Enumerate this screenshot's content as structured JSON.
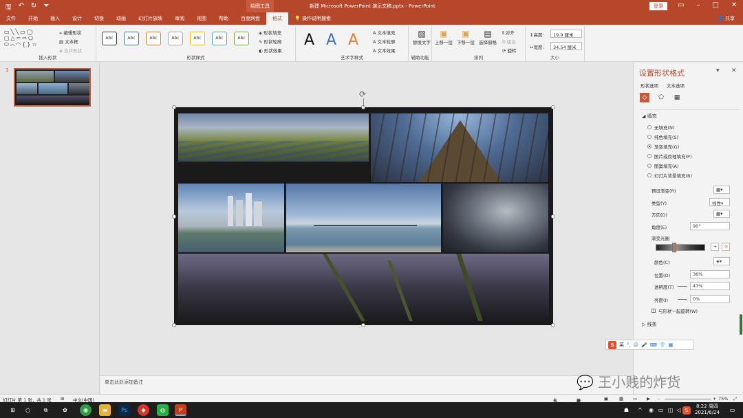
{
  "titlebar": {
    "context_tab": "绘图工具",
    "document_title": "新建 Microsoft PowerPoint 演示文稿.pptx  -  PowerPoint",
    "login_label": "登录",
    "share_label": "共享"
  },
  "tabs": [
    "文件",
    "开始",
    "插入",
    "设计",
    "切换",
    "动画",
    "幻灯片放映",
    "审阅",
    "视图",
    "帮助",
    "百度网盘",
    "格式",
    "操作说明搜索"
  ],
  "ribbon": {
    "insert_shapes": {
      "label": "插入形状",
      "edit_shape": "编辑形状",
      "text_box": "文本框",
      "merge_shapes": "合并形状"
    },
    "shape_styles": {
      "label": "形状样式",
      "preset": "Abc",
      "fill": "形状填充",
      "outline": "形状轮廓",
      "effects": "形状效果"
    },
    "wordart": {
      "label": "艺术字样式",
      "letter": "A",
      "text_fill": "文本填充",
      "text_outline": "文本轮廓",
      "text_effects": "文本效果"
    },
    "accessibility": {
      "label": "辅助功能",
      "alt_text": "替换文字"
    },
    "arrange": {
      "label": "排列",
      "bring_forward": "上移一层",
      "send_backward": "下移一层",
      "selection_pane": "选择窗格",
      "align": "对齐",
      "group": "组合",
      "rotate": "旋转"
    },
    "size": {
      "label": "大小",
      "height_label": "高度:",
      "height_value": "19.9 厘米",
      "width_label": "宽度:",
      "width_value": "34.54 厘米"
    }
  },
  "slides_panel": {
    "slide_number": "1"
  },
  "notes": {
    "placeholder": "单击此处添加备注"
  },
  "format_pane": {
    "title": "设置形状格式",
    "subtabs": [
      "形状选项",
      "文本选项"
    ],
    "fill_section": "填充",
    "fill_options": [
      "无填充(N)",
      "纯色填充(S)",
      "渐变填充(G)",
      "图片或纹理填充(P)",
      "图案填充(A)",
      "幻灯片背景填充(B)"
    ],
    "selected_fill": "渐变填充(G)",
    "preset_gradient": "预设渐变(R)",
    "type_label": "类型(Y)",
    "type_value": "线性",
    "direction_label": "方向(D)",
    "angle_label": "角度(E)",
    "angle_value": "90°",
    "gradient_stops": "渐变光圈",
    "color_label": "颜色(C)",
    "position_label": "位置(O)",
    "position_value": "36%",
    "transparency_label": "透明度(T)",
    "transparency_value": "47%",
    "brightness_label": "亮度(I)",
    "brightness_value": "0%",
    "rotate_with_shape": "与形状一起旋转(W)",
    "line_section": "线条"
  },
  "ime": {
    "lang": "英"
  },
  "watermark": "王小贱的炸货",
  "statusbar": {
    "slide_info": "幻灯片 第 1 张，共 1 张",
    "language": "中文(中国)",
    "notes_btn": "备注",
    "comments_btn": "批注",
    "zoom": "75%"
  },
  "taskbar": {
    "time": "8:22 周四",
    "date": "2021/6/24",
    "ime_indicator": "英"
  },
  "colors": {
    "accent": "#b7472a"
  }
}
